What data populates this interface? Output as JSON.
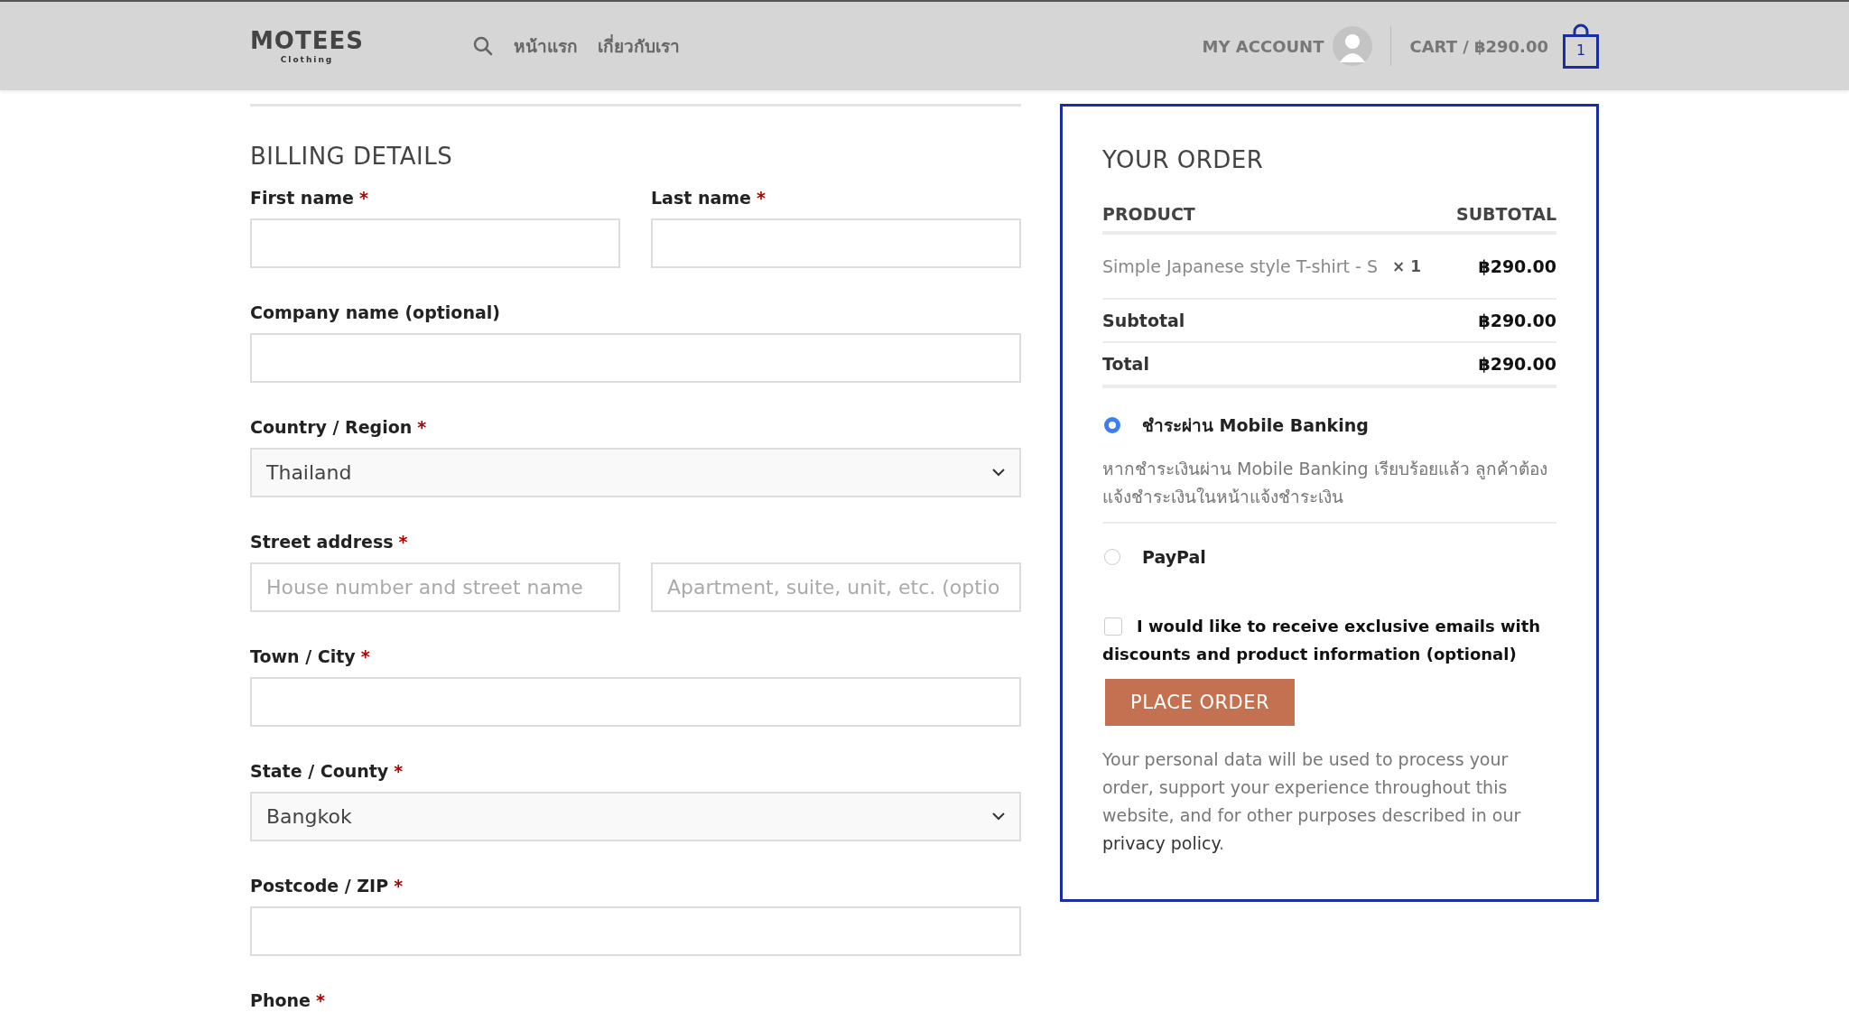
{
  "header": {
    "logo": {
      "text": "MOTEES",
      "subtext": "Clothing"
    },
    "nav": [
      "หน้าแรก",
      "เกี่ยวกับเรา"
    ],
    "account": "MY ACCOUNT",
    "cart": "CART / ฿290.00",
    "cart_count": "1"
  },
  "billing": {
    "title": "BILLING DETAILS",
    "rows": [
      {
        "fields": [
          {
            "label": "First name",
            "required_mark": "*",
            "kind": "input"
          },
          {
            "label": "Last name",
            "required_mark": "*",
            "kind": "input"
          }
        ]
      },
      {
        "fields": [
          {
            "label": "Company name (optional)",
            "kind": "input"
          }
        ]
      },
      {
        "fields": [
          {
            "label": "Country / Region",
            "required_mark": "*",
            "kind": "select",
            "value": "Thailand"
          }
        ]
      },
      {
        "fields": [
          {
            "label": "Street address",
            "required_mark": "*",
            "kind": "input",
            "placeholder": "House number and street name"
          },
          {
            "kind": "input",
            "placeholder": "Apartment, suite, unit, etc. (optio"
          }
        ]
      },
      {
        "fields": [
          {
            "label": "Town / City",
            "required_mark": "*",
            "kind": "input"
          }
        ]
      },
      {
        "fields": [
          {
            "label": "State / County",
            "required_mark": "*",
            "kind": "select",
            "value": "Bangkok"
          }
        ]
      },
      {
        "fields": [
          {
            "label": "Postcode / ZIP",
            "required_mark": "*",
            "kind": "input"
          }
        ]
      },
      {
        "fields": [
          {
            "label": "Phone",
            "required_mark": "*",
            "kind": "label"
          }
        ]
      }
    ]
  },
  "order": {
    "title": "YOUR ORDER",
    "columns": [
      "PRODUCT",
      "SUBTOTAL"
    ],
    "items": [
      {
        "name": "Simple Japanese style T-shirt - S",
        "qty": "× 1",
        "price": "฿290.00"
      }
    ],
    "totals": [
      {
        "label": "Subtotal",
        "value": "฿290.00"
      },
      {
        "label": "Total",
        "value": "฿290.00"
      }
    ],
    "payments": [
      {
        "label": "ชำระผ่าน Mobile Banking",
        "selected": true,
        "description": "หากชำระเงินผ่าน Mobile Banking เรียบร้อยแล้ว ลูกค้าต้องแจ้งชำระเงินในหน้าแจ้งชำระเงิน"
      },
      {
        "label": "PayPal",
        "selected": false
      }
    ],
    "newsletter": {
      "label": "I would like to receive exclusive emails with discounts and product information (optional)",
      "checked": false
    },
    "button": "PLACE ORDER",
    "privacy": {
      "text": "Your personal data will be used to process your order, support your experience throughout this website, and for other purposes described in our",
      "link": "privacy policy",
      "end": "."
    }
  }
}
